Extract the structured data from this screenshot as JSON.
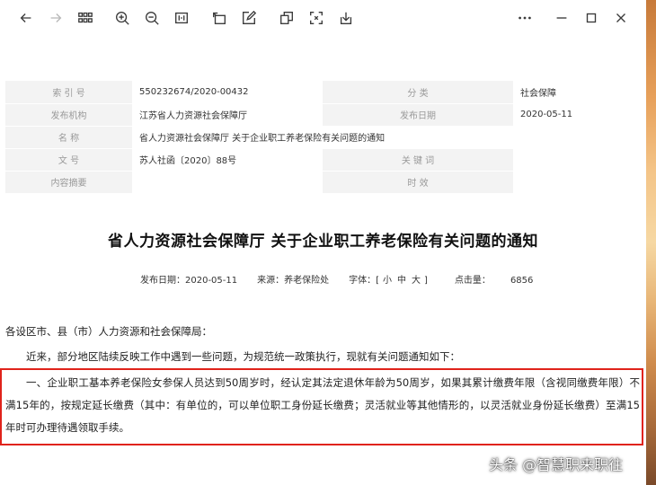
{
  "toolbar": {
    "icons": [
      "back-arrow-icon",
      "forward-arrow-icon",
      "grid-icon",
      "zoom-in-icon",
      "zoom-out-icon",
      "fit-page-icon",
      "rotate-icon",
      "edit-icon",
      "copy-icon",
      "screenshot-icon",
      "download-icon",
      "more-icon",
      "minimize-icon",
      "maximize-icon",
      "close-icon"
    ]
  },
  "meta": {
    "rows": [
      {
        "label1": "索  引  号",
        "value1": "550232674/2020-00432",
        "label2": "分    类",
        "value2": "社会保障"
      },
      {
        "label1": "发布机构",
        "value1": "江苏省人力资源社会保障厅",
        "label2": "发布日期",
        "value2": "2020-05-11"
      },
      {
        "label1": "名    称",
        "value1": "省人力资源社会保障厅 关于企业职工养老保险有关问题的通知",
        "label2": "",
        "value2": ""
      },
      {
        "label1": "文    号",
        "value1": "苏人社函〔2020〕88号",
        "label2": "关  键  词",
        "value2": ""
      },
      {
        "label1": "内容摘要",
        "value1": "",
        "label2": "时    效",
        "value2": ""
      }
    ]
  },
  "doc": {
    "title": "省人力资源社会保障厅 关于企业职工养老保险有关问题的通知",
    "publish_date_label": "发布日期：",
    "publish_date": "2020-05-11",
    "source_label": "来源：",
    "source": "养老保险处",
    "font_label": "字体：[",
    "font_small": "小",
    "font_medium": "中",
    "font_large": "大",
    "font_close": "]",
    "hits_label": "点击量：",
    "hits": "6856",
    "salutation": "各设区市、县（市）人力资源和社会保障局：",
    "intro": "近来，部分地区陆续反映工作中遇到一些问题，为规范统一政策执行，现就有关问题通知如下：",
    "para1": "一、企业职工基本养老保险女参保人员达到50周岁时，经认定其法定退休年龄为50周岁，如果其累计缴费年限（含视同缴费年限）不满15年的，按规定延长缴费（其中：有单位的，可以单位职工身份延长缴费；灵活就业等其他情形的，以灵活就业身份延长缴费）至满15年时可办理待遇领取手续。"
  },
  "watermark": "头条 @智慧职来职往",
  "colors": {
    "highlight_border": "#e0231b",
    "label_bg": "#f3f3f3"
  }
}
